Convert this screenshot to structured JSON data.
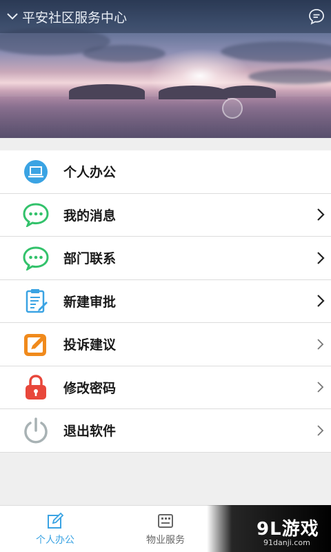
{
  "header": {
    "title": "平安社区服务中心",
    "back_icon": "chevron-down-icon",
    "message_icon": "chat-bubble-icon"
  },
  "menu": {
    "items": [
      {
        "label": "个人办公",
        "icon": "laptop-icon",
        "has_chevron": false
      },
      {
        "label": "我的消息",
        "icon": "chat-bubble-icon",
        "has_chevron": true
      },
      {
        "label": "部门联系",
        "icon": "chat-bubble-icon",
        "has_chevron": true
      },
      {
        "label": "新建审批",
        "icon": "clipboard-edit-icon",
        "has_chevron": true
      },
      {
        "label": "投诉建议",
        "icon": "pencil-edit-icon",
        "has_chevron": true
      },
      {
        "label": "修改密码",
        "icon": "lock-icon",
        "has_chevron": true
      },
      {
        "label": "退出软件",
        "icon": "power-icon",
        "has_chevron": true
      }
    ]
  },
  "bottom_nav": {
    "tabs": [
      {
        "label": "个人办公",
        "icon": "edit-square-icon",
        "active": true
      },
      {
        "label": "物业服务",
        "icon": "list-board-icon",
        "active": false
      }
    ]
  },
  "watermark": {
    "brand": "9L游戏",
    "site": "91danji.com"
  },
  "colors": {
    "accent": "#3aa3e3",
    "green": "#33c26b",
    "orange": "#f08a1c",
    "red": "#e8473b",
    "gray_icon": "#a8b2b4"
  }
}
